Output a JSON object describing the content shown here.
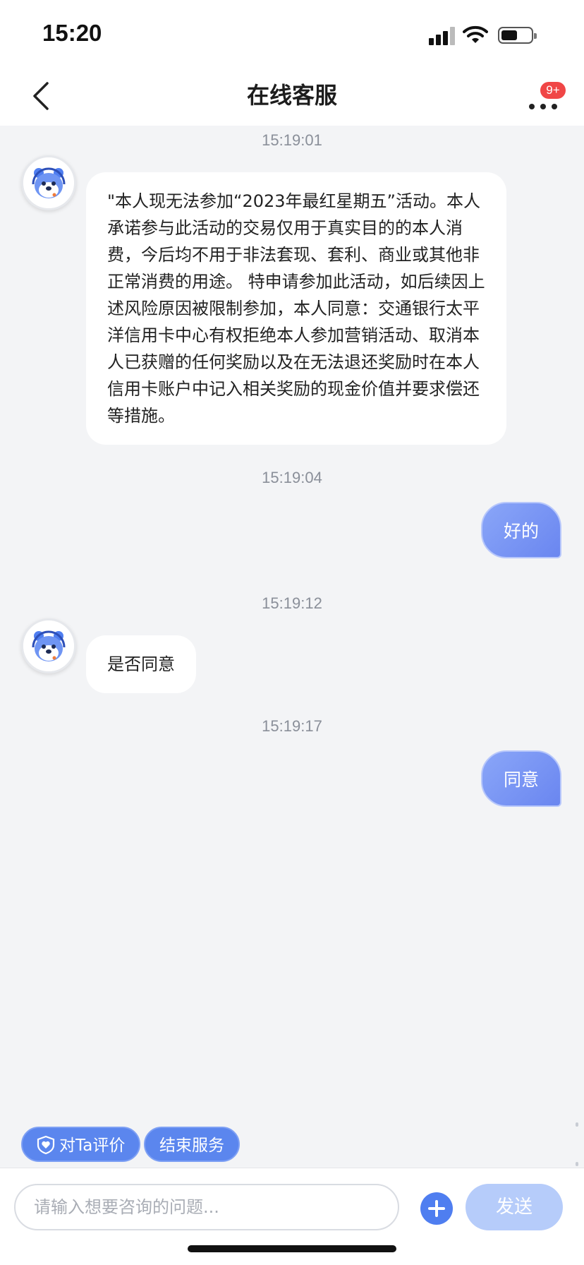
{
  "status_bar": {
    "time": "15:20"
  },
  "header": {
    "title": "在线客服",
    "badge": "9+"
  },
  "messages": [
    {
      "timestamp": "15:19:01",
      "from": "agent",
      "text": "\"本人现无法参加“2023年最红星期五”活动。本人承诺参与此活动的交易仅用于真实目的的本人消费，今后均不用于非法套现、套利、商业或其他非正常消费的用途。 特申请参加此活动，如后续因上述风险原因被限制参加，本人同意：交通银行太平洋信用卡中心有权拒绝本人参加营销活动、取消本人已获赠的任何奖励以及在无法退还奖励时在本人信用卡账户中记入相关奖励的现金价值并要求偿还等措施。"
    },
    {
      "timestamp": "15:19:04",
      "from": "user",
      "text": "好的"
    },
    {
      "timestamp": "15:19:12",
      "from": "agent",
      "text": "是否同意"
    },
    {
      "timestamp": "15:19:17",
      "from": "user",
      "text": "同意"
    }
  ],
  "quick_actions": {
    "rate_label": "对Ta评价",
    "end_label": "结束服务"
  },
  "input": {
    "placeholder": "请输入想要咨询的问题...",
    "value": "",
    "send_label": "发送"
  },
  "colors": {
    "accent": "#5b86ee",
    "user_bubble": "#7a96f4",
    "send_disabled": "#b6ccfa",
    "badge": "#f04646",
    "background": "#f3f4f6"
  },
  "icons": {
    "back": "chevron-left-icon",
    "more": "more-dots-icon",
    "plus": "plus-circle-icon",
    "rate": "shield-heart-icon"
  }
}
